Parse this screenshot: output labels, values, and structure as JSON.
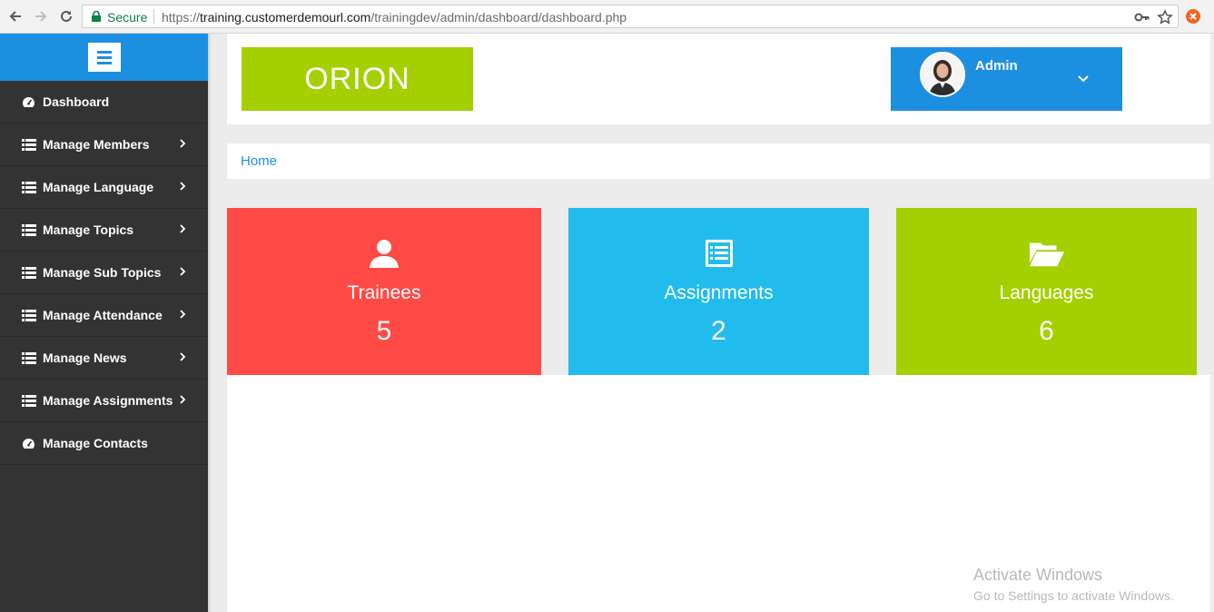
{
  "browser": {
    "secure_label": "Secure",
    "url_scheme": "https://",
    "url_host": "training.customerdemourl.com",
    "url_path": "/trainingdev/admin/dashboard/dashboard.php"
  },
  "sidebar": {
    "items": [
      {
        "label": "Dashboard",
        "icon": "dashboard-icon",
        "has_submenu": false
      },
      {
        "label": "Manage Members",
        "icon": "list-icon",
        "has_submenu": true
      },
      {
        "label": "Manage Language",
        "icon": "list-icon",
        "has_submenu": true
      },
      {
        "label": "Manage Topics",
        "icon": "list-icon",
        "has_submenu": true
      },
      {
        "label": "Manage Sub Topics",
        "icon": "list-icon",
        "has_submenu": true
      },
      {
        "label": "Manage Attendance",
        "icon": "list-icon",
        "has_submenu": true
      },
      {
        "label": "Manage News",
        "icon": "list-icon",
        "has_submenu": true
      },
      {
        "label": "Manage Assignments",
        "icon": "list-icon",
        "has_submenu": true
      },
      {
        "label": "Manage Contacts",
        "icon": "dashboard-icon",
        "has_submenu": false
      }
    ]
  },
  "header": {
    "logo_text": "ORION",
    "user_name": "Admin"
  },
  "breadcrumb": {
    "home": "Home"
  },
  "stats": [
    {
      "label": "Trainees",
      "count": "5",
      "color": "#ff4a45",
      "icon": "user-icon"
    },
    {
      "label": "Assignments",
      "count": "2",
      "color": "#22bcec",
      "icon": "list-alt-icon"
    },
    {
      "label": "Languages",
      "count": "6",
      "color": "#a4d000",
      "icon": "folder-open-icon"
    }
  ],
  "watermark": {
    "title": "Activate Windows",
    "subtitle": "Go to Settings to activate Windows."
  },
  "colors": {
    "primary": "#1d8fe0",
    "sidebar": "#333333",
    "brand_green": "#a4d000"
  }
}
